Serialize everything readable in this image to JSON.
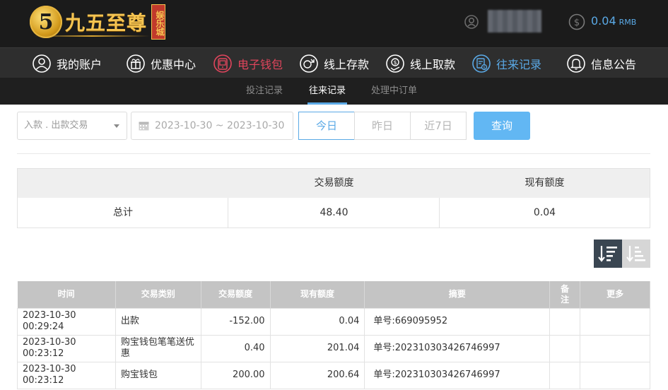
{
  "header": {
    "brand": {
      "mark": "5",
      "name": "九五至尊",
      "sub": "娱乐城"
    },
    "balance": {
      "amount": "0.04",
      "currency": "RMB"
    },
    "accent": "#5aa9e6",
    "brand_gold": "#f5c451"
  },
  "nav": {
    "items": [
      {
        "label": "我的账户",
        "icon": "user-circle-icon"
      },
      {
        "label": "优惠中心",
        "icon": "gift-icon"
      },
      {
        "label": "电子钱包",
        "icon": "wallet-icon"
      },
      {
        "label": "线上存款",
        "icon": "deposit-icon"
      },
      {
        "label": "线上取款",
        "icon": "withdraw-icon"
      },
      {
        "label": "往来记录",
        "icon": "records-icon"
      },
      {
        "label": "信息公告",
        "icon": "bell-icon"
      }
    ],
    "active_color": "#5aa9e6",
    "highlight_color": "#e0455c"
  },
  "subnav": {
    "items": [
      {
        "label": "投注记录"
      },
      {
        "label": "往来记录"
      },
      {
        "label": "处理中订单"
      }
    ],
    "active_index": 1
  },
  "filters": {
    "type_select": "入款 . 出款交易",
    "date_range": "2023-10-30 ~ 2023-10-30",
    "quick": [
      {
        "label": "今日"
      },
      {
        "label": "昨日"
      },
      {
        "label": "近7日"
      }
    ],
    "query_label": "查询"
  },
  "summary": {
    "col_amount": "交易额度",
    "col_balance": "现有额度",
    "row_label": "总计",
    "amount": "48.40",
    "balance": "0.04"
  },
  "records": {
    "headers": [
      "时间",
      "交易类别",
      "交易额度",
      "现有额度",
      "摘要",
      "备注",
      "更多"
    ],
    "rows": [
      {
        "time": "2023-10-30 00:29:24",
        "type": "出款",
        "amount": "-152.00",
        "balance": "0.04",
        "summary": "单号:669095952",
        "note": "",
        "more": ""
      },
      {
        "time": "2023-10-30 00:23:12",
        "type": "购宝钱包笔笔送优惠",
        "amount": "0.40",
        "balance": "201.04",
        "summary": "单号:202310303426746997",
        "note": "",
        "more": ""
      },
      {
        "time": "2023-10-30 00:23:12",
        "type": "购宝钱包",
        "amount": "200.00",
        "balance": "200.64",
        "summary": "单号:202310303426746997",
        "note": "",
        "more": ""
      }
    ]
  }
}
